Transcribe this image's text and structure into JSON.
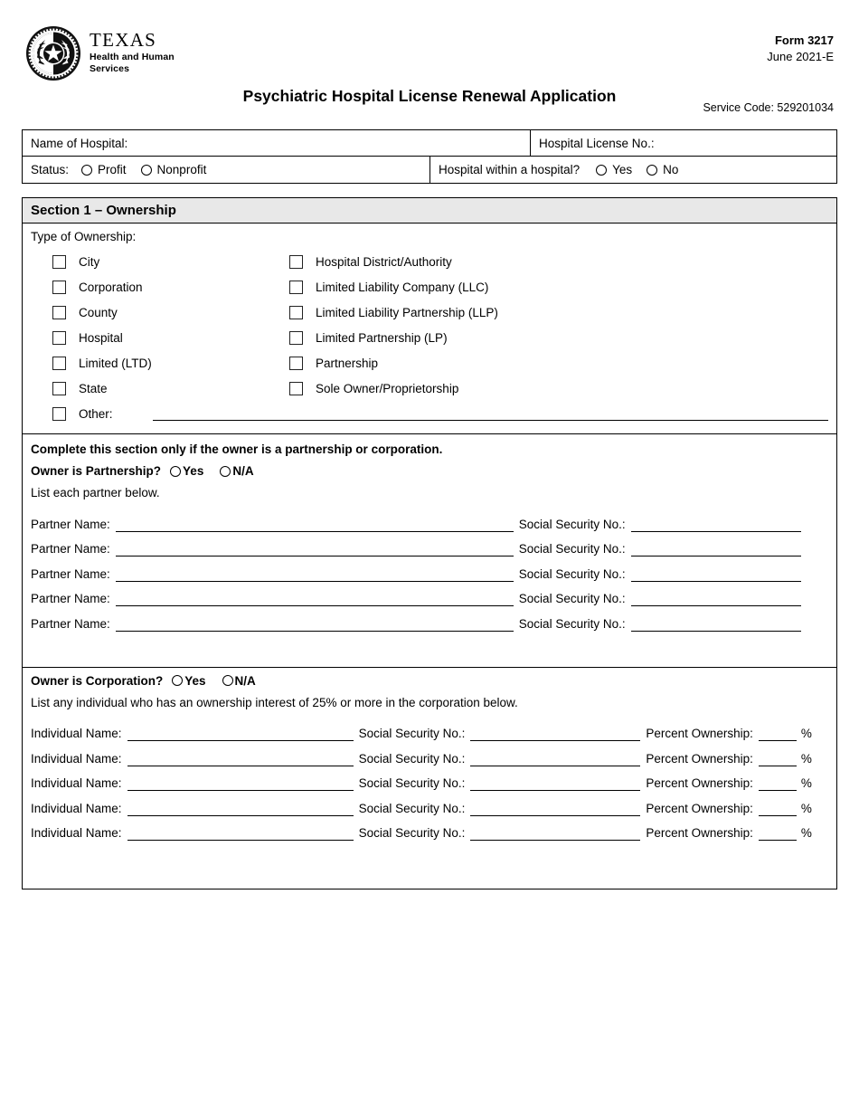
{
  "header": {
    "logo_texas": "TEXAS",
    "logo_sub_line1": "Health and Human",
    "logo_sub_line2": "Services",
    "form_number": "Form 3217",
    "form_date": "June 2021-E",
    "title": "Psychiatric Hospital License Renewal Application",
    "service_code": "Service Code: 529201034"
  },
  "info_table": {
    "name_of_hospital_label": "Name of Hospital:",
    "hospital_license_no_label": "Hospital License No.:",
    "status_label": "Status:",
    "status_options": [
      "Profit",
      "Nonprofit"
    ],
    "hospital_within_hospital_label": "Hospital within a hospital?",
    "hospital_within_hospital_options": [
      "Yes",
      "No"
    ]
  },
  "section1": {
    "heading": "Section 1 – Ownership",
    "ownership": {
      "title": "Type of Ownership:",
      "left_options": [
        "City",
        "Corporation",
        "County",
        "Hospital",
        "Limited (LTD)",
        "State",
        "Other:"
      ],
      "right_options": [
        "Hospital District/Authority",
        "Limited Liability Company (LLC)",
        "Limited Liability Partnership (LLP)",
        "Limited Partnership (LP)",
        "Partnership",
        "Sole Owner/Proprietorship"
      ]
    },
    "partnership": {
      "note": "Complete this section only if the owner is a partnership or corporation.",
      "question": "Owner is Partnership?",
      "options": [
        "Yes",
        "N/A"
      ],
      "instruction": "List each partner below.",
      "name_label": "Partner Name:",
      "ssn_label": "Social Security No.:",
      "rows": [
        1,
        2,
        3,
        4,
        5
      ]
    },
    "corporation": {
      "question": "Owner is Corporation?",
      "options": [
        "Yes",
        "N/A"
      ],
      "instruction": "List any individual who has an ownership interest of 25% or more in the corporation below.",
      "name_label": "Individual Name:",
      "ssn_label": "Social Security No.:",
      "percent_label": "Percent Ownership:",
      "percent_sign": "%",
      "rows": [
        1,
        2,
        3,
        4,
        5
      ]
    }
  },
  "colors": {
    "section_band": "#e8e8e8",
    "border": "#000000",
    "text": "#000000"
  }
}
